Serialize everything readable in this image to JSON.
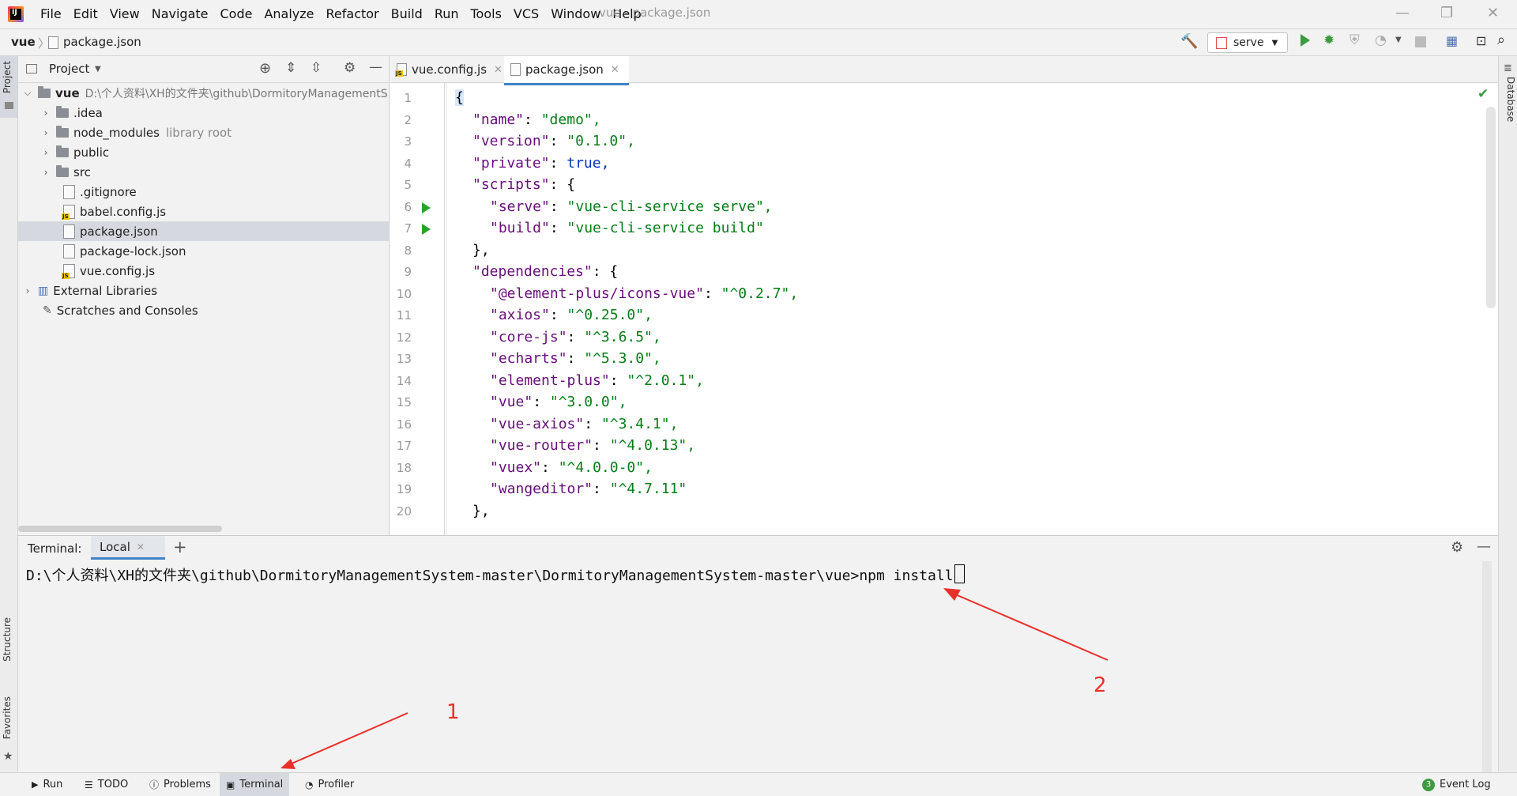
{
  "app": {
    "window_title": "vue - package.json",
    "logo_text": "IJ"
  },
  "menu": [
    "File",
    "Edit",
    "View",
    "Navigate",
    "Code",
    "Analyze",
    "Refactor",
    "Build",
    "Run",
    "Tools",
    "VCS",
    "Window",
    "Help"
  ],
  "breadcrumb": {
    "project": "vue",
    "file": "package.json"
  },
  "toolbar": {
    "run_config": "serve"
  },
  "project_panel": {
    "title": "Project",
    "root": {
      "name": "vue",
      "path": "D:\\个人资料\\XH的文件夹\\github\\DormitoryManagementS"
    },
    "items": [
      {
        "label": ".idea",
        "type": "folder",
        "note": ""
      },
      {
        "label": "node_modules",
        "type": "folder",
        "note": "library root"
      },
      {
        "label": "public",
        "type": "folder",
        "note": ""
      },
      {
        "label": "src",
        "type": "folder",
        "note": ""
      },
      {
        "label": ".gitignore",
        "type": "file",
        "note": ""
      },
      {
        "label": "babel.config.js",
        "type": "js",
        "note": ""
      },
      {
        "label": "package.json",
        "type": "file",
        "note": ""
      },
      {
        "label": "package-lock.json",
        "type": "file",
        "note": ""
      },
      {
        "label": "vue.config.js",
        "type": "js",
        "note": ""
      }
    ],
    "external_libraries": "External Libraries",
    "scratches": "Scratches and Consoles"
  },
  "editor": {
    "tabs": [
      {
        "label": "vue.config.js"
      },
      {
        "label": "package.json"
      }
    ],
    "line_numbers": [
      "1",
      "2",
      "3",
      "4",
      "5",
      "6",
      "7",
      "8",
      "9",
      "10",
      "11",
      "12",
      "13",
      "14",
      "15",
      "16",
      "17",
      "18",
      "19",
      "20"
    ],
    "lines": [
      {
        "k": "",
        "v": "{"
      },
      {
        "k": "\"name\"",
        "v": "\"demo\","
      },
      {
        "k": "\"version\"",
        "v": "\"0.1.0\","
      },
      {
        "k": "\"private\"",
        "v": "true,"
      },
      {
        "k": "\"scripts\"",
        "v": "{"
      },
      {
        "k": "\"serve\"",
        "v": "\"vue-cli-service serve\","
      },
      {
        "k": "\"build\"",
        "v": "\"vue-cli-service build\""
      },
      {
        "k": "",
        "v": "},"
      },
      {
        "k": "\"dependencies\"",
        "v": "{"
      },
      {
        "k": "\"@element-plus/icons-vue\"",
        "v": "\"^0.2.7\","
      },
      {
        "k": "\"axios\"",
        "v": "\"^0.25.0\","
      },
      {
        "k": "\"core-js\"",
        "v": "\"^3.6.5\","
      },
      {
        "k": "\"echarts\"",
        "v": "\"^5.3.0\","
      },
      {
        "k": "\"element-plus\"",
        "v": "\"^2.0.1\","
      },
      {
        "k": "\"vue\"",
        "v": "\"^3.0.0\","
      },
      {
        "k": "\"vue-axios\"",
        "v": "\"^3.4.1\","
      },
      {
        "k": "\"vue-router\"",
        "v": "\"^4.0.13\","
      },
      {
        "k": "\"vuex\"",
        "v": "\"^4.0.0-0\","
      },
      {
        "k": "\"wangeditor\"",
        "v": "\"^4.7.11\""
      },
      {
        "k": "",
        "v": "},"
      }
    ]
  },
  "terminal": {
    "label": "Terminal:",
    "tab": "Local",
    "prompt": "D:\\个人资料\\XH的文件夹\\github\\DormitoryManagementSystem-master\\DormitoryManagementSystem-master\\vue>",
    "command": "npm install"
  },
  "annotations": {
    "one": "1",
    "two": "2"
  },
  "side_tabs": {
    "project": "Project",
    "structure": "Structure",
    "favorites": "Favorites",
    "database": "Database"
  },
  "bottom_tabs": [
    "Run",
    "TODO",
    "Problems",
    "Terminal",
    "Profiler"
  ],
  "event_log": {
    "count": "3",
    "label": "Event Log"
  }
}
